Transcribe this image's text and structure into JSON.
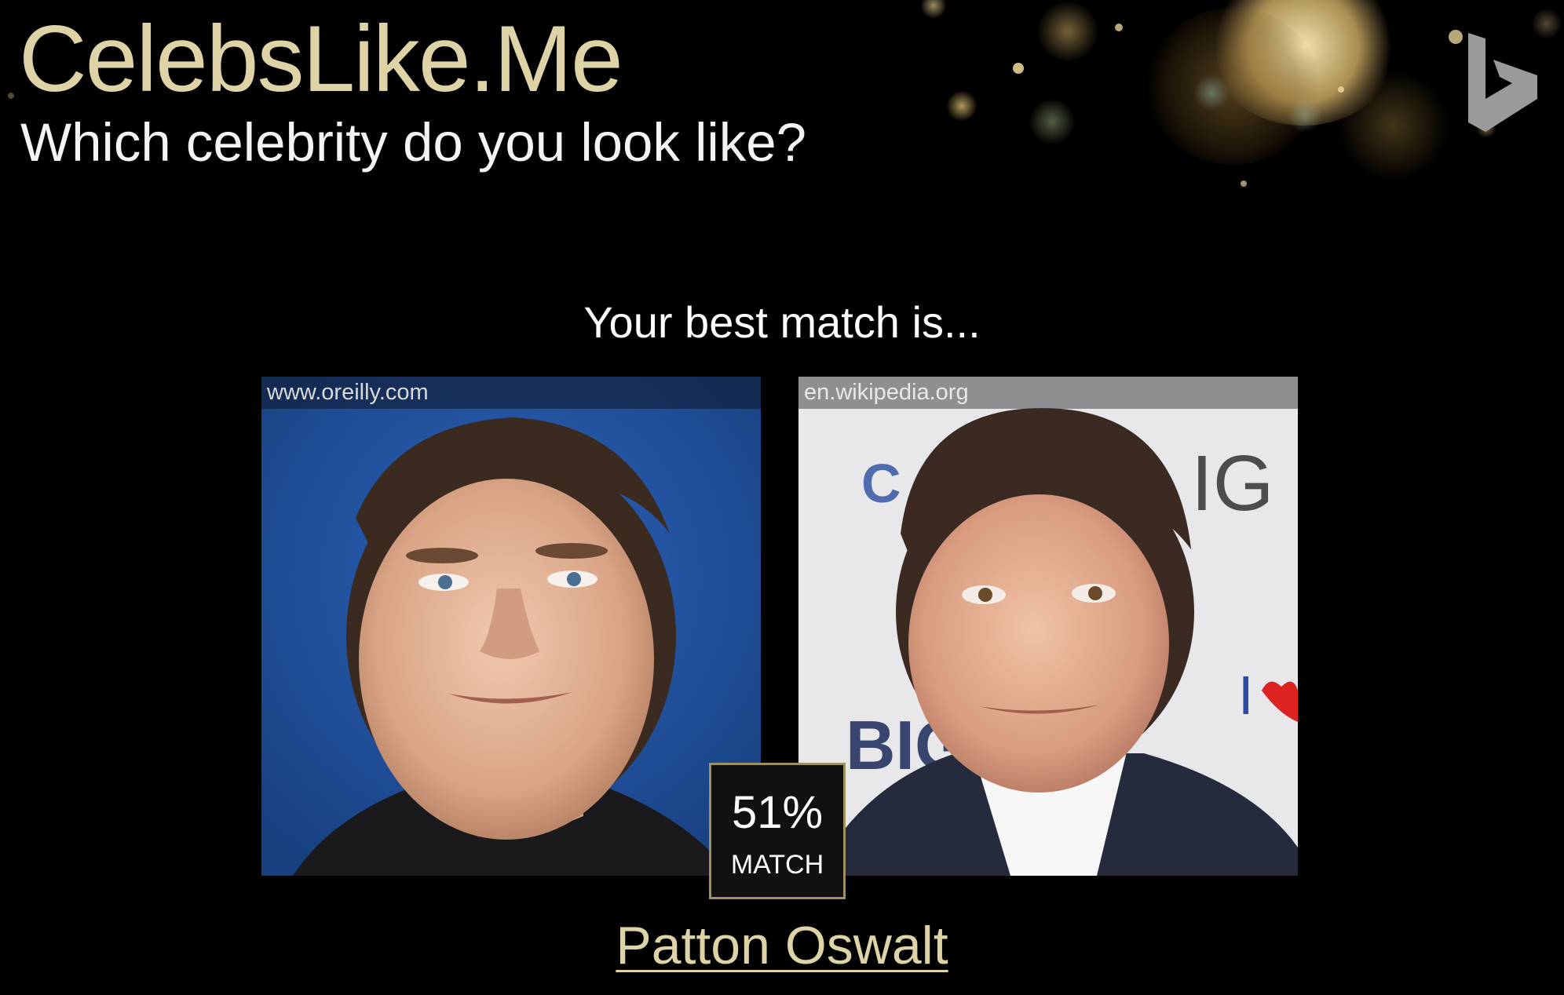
{
  "site": {
    "title": "CelebsLike.Me",
    "tagline": "Which celebrity do you look like?",
    "logo_icon": "bing-logo-icon"
  },
  "result": {
    "heading": "Your best match is...",
    "user_photo": {
      "source": "www.oreilly.com"
    },
    "celebrity_photo": {
      "source": "en.wikipedia.org"
    },
    "match_percent": "51%",
    "match_label": "MATCH",
    "celebrity_name": "Patton Oswalt"
  },
  "colors": {
    "background": "#000000",
    "accent_gold": "#ddd3a6",
    "badge_border": "#9e9161",
    "text": "#ffffff"
  }
}
